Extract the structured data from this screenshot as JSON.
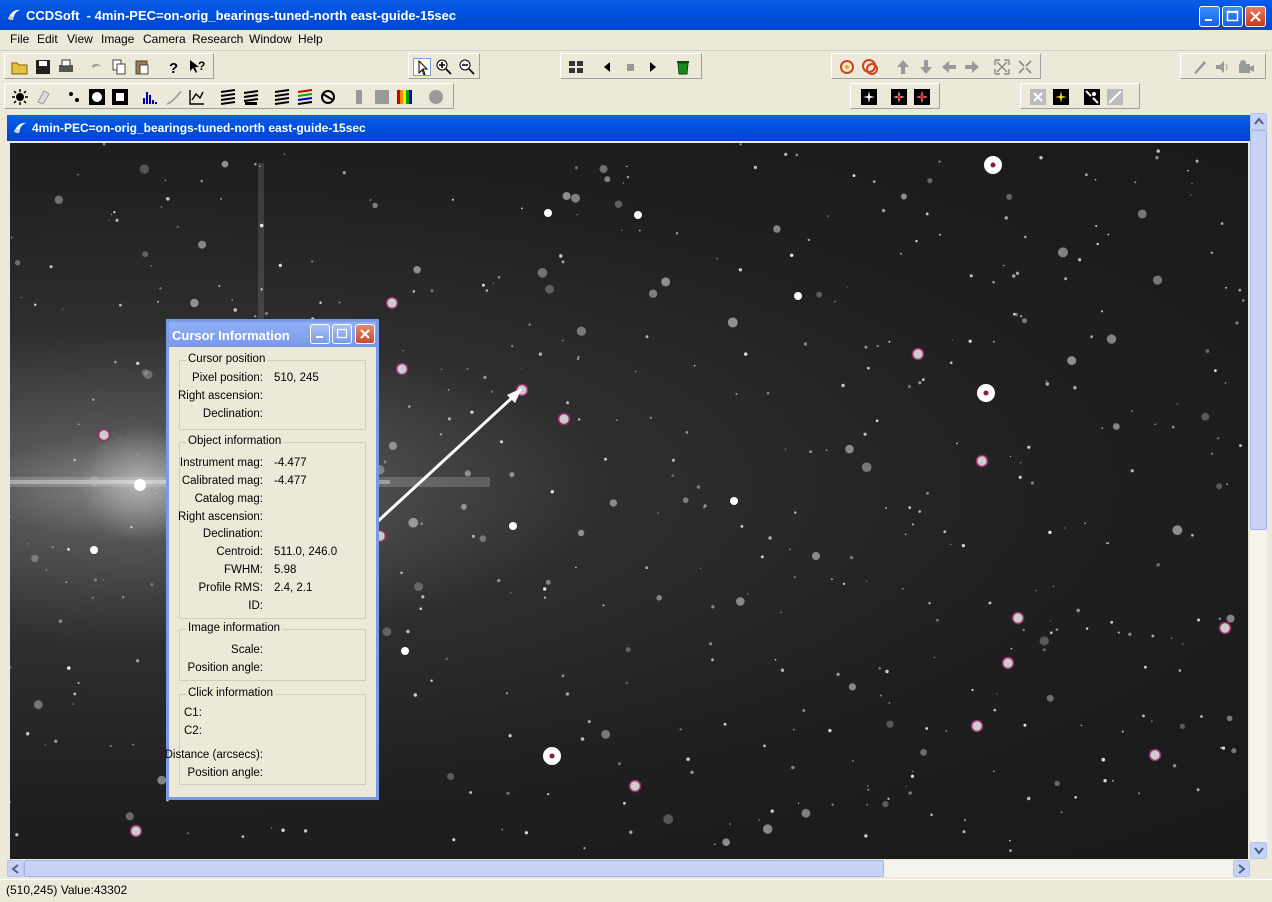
{
  "app": {
    "title": "CCDSoft  - 4min-PEC=on-orig_bearings-tuned-north east-guide-15sec"
  },
  "menu": [
    "File",
    "Edit",
    "View",
    "Image",
    "Camera",
    "Research",
    "Window",
    "Help"
  ],
  "child_window": {
    "title": "4min-PEC=on-orig_bearings-tuned-north east-guide-15sec"
  },
  "cursor_info": {
    "title": "Cursor Information",
    "cursor_position": {
      "group": "Cursor position",
      "pixel_label": "Pixel position:",
      "pixel_value": "510, 245",
      "ra_label": "Right ascension:",
      "dec_label": "Declination:"
    },
    "object_information": {
      "group": "Object information",
      "inst_mag_label": "Instrument mag:",
      "inst_mag_value": "-4.477",
      "cal_mag_label": "Calibrated mag:",
      "cal_mag_value": "-4.477",
      "cat_mag_label": "Catalog mag:",
      "ra_label": "Right ascension:",
      "dec_label": "Declination:",
      "centroid_label": "Centroid:",
      "centroid_value": "511.0, 246.0",
      "fwhm_label": "FWHM:",
      "fwhm_value": "5.98",
      "rms_label": "Profile RMS:",
      "rms_value": "2.4, 2.1",
      "id_label": "ID:"
    },
    "image_information": {
      "group": "Image information",
      "scale_label": "Scale:",
      "angle_label": "Position angle:"
    },
    "click_information": {
      "group": "Click information",
      "c1_label": "C1:",
      "c2_label": "C2:",
      "distance_label": "Distance (arcsecs):",
      "angle_label": "Position angle:"
    }
  },
  "status": {
    "text": "(510,245) Value:43302"
  },
  "colors": {
    "titlebar": "#0052E0",
    "inactive_dialog": "#7A9AE8",
    "background": "#ECE9D8"
  }
}
